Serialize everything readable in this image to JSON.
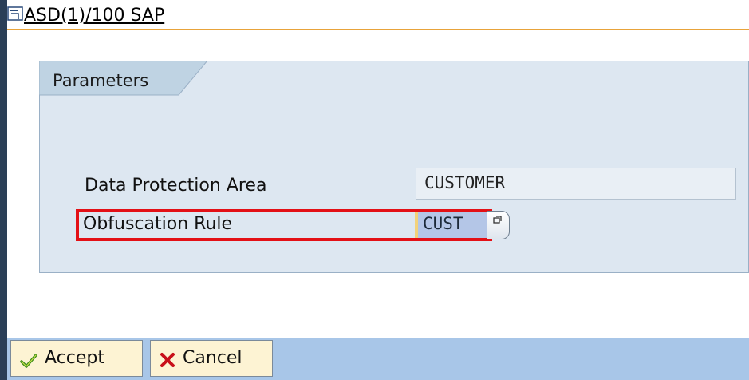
{
  "window": {
    "title": "ASD(1)/100 SAP",
    "icon": "window-menu-icon"
  },
  "group": {
    "title": "Parameters"
  },
  "fields": [
    {
      "label": "Data Protection Area",
      "value": "CUSTOMER"
    },
    {
      "label": "Obfuscation Rule",
      "value": "CUST"
    }
  ],
  "value_help": {
    "icon": "f4-value-help-icon"
  },
  "buttons": {
    "accept_label": "Accept",
    "accept_icon": "checkmark-icon",
    "cancel_label": "Cancel",
    "cancel_icon": "cross-icon"
  },
  "colors": {
    "accent_line": "#e8a33a",
    "highlight": "#e31016",
    "footer": "#a8c6e8",
    "group_bg": "#dde7f1"
  }
}
